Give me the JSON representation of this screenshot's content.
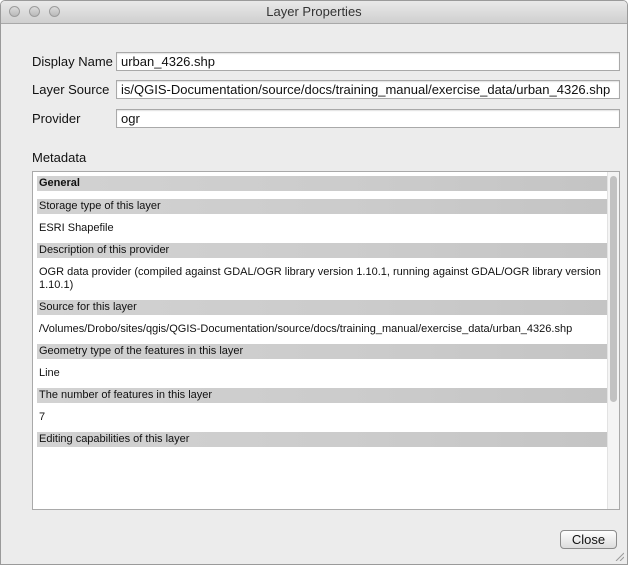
{
  "window": {
    "title": "Layer Properties"
  },
  "form": {
    "display_name_label": "Display Name",
    "display_name_value": "urban_4326.shp",
    "layer_source_label": "Layer Source",
    "layer_source_value": "is/QGIS-Documentation/source/docs/training_manual/exercise_data/urban_4326.shp",
    "provider_label": "Provider",
    "provider_value": "ogr"
  },
  "metadata": {
    "label": "Metadata",
    "sections": [
      {
        "header": "General",
        "bold": true
      },
      {
        "header": "Storage type of this layer",
        "value": "ESRI Shapefile"
      },
      {
        "header": "Description of this provider",
        "value": "OGR data provider (compiled against GDAL/OGR library version 1.10.1, running against GDAL/OGR library version 1.10.1)"
      },
      {
        "header": "Source for this layer",
        "value": "/Volumes/Drobo/sites/qgis/QGIS-Documentation/source/docs/training_manual/exercise_data/urban_4326.shp"
      },
      {
        "header": "Geometry type of the features in this layer",
        "value": "Line"
      },
      {
        "header": "The number of features in this layer",
        "value": "7"
      },
      {
        "header": "Editing capabilities of this layer",
        "value": ""
      }
    ]
  },
  "buttons": {
    "close_label": "Close"
  }
}
